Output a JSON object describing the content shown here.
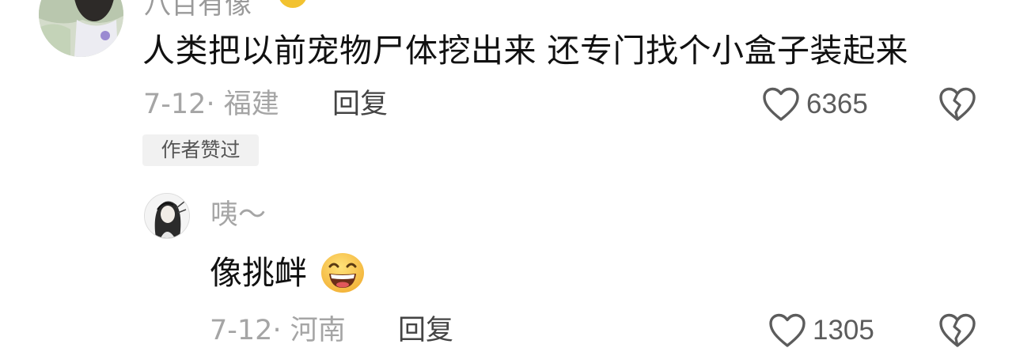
{
  "comment": {
    "author_cutoff": "八百有像",
    "text": "人类把以前宠物尸体挖出来 还专门找个小盒子装起来",
    "date": "7-12",
    "location": "福建",
    "reply_label": "回复",
    "likes": "6365",
    "author_badge": "作者赞过"
  },
  "reply": {
    "author": "咦～",
    "text": "像挑衅",
    "emoji": "grinning-face-emoji",
    "date": "7-12",
    "location": "河南",
    "reply_label": "回复",
    "likes": "1305"
  },
  "icons": {
    "like": "heart-outline-icon",
    "dislike": "broken-heart-icon"
  },
  "colors": {
    "meta_text": "#a5a5a5",
    "icon_stroke": "#5c5c5c",
    "badge_bg": "#f1f1f1"
  }
}
